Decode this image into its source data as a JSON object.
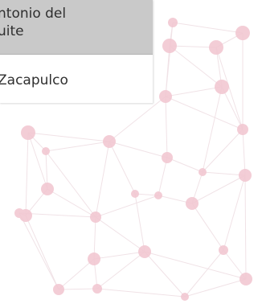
{
  "dropdown": {
    "options": [
      {
        "line1": "ntonio del",
        "line2": "uite",
        "highlighted": true
      },
      {
        "line1": "Zacapulco",
        "highlighted": false
      }
    ]
  },
  "background": {
    "node_color": "#f3c7d2",
    "line_color": "#f1dfe4"
  }
}
